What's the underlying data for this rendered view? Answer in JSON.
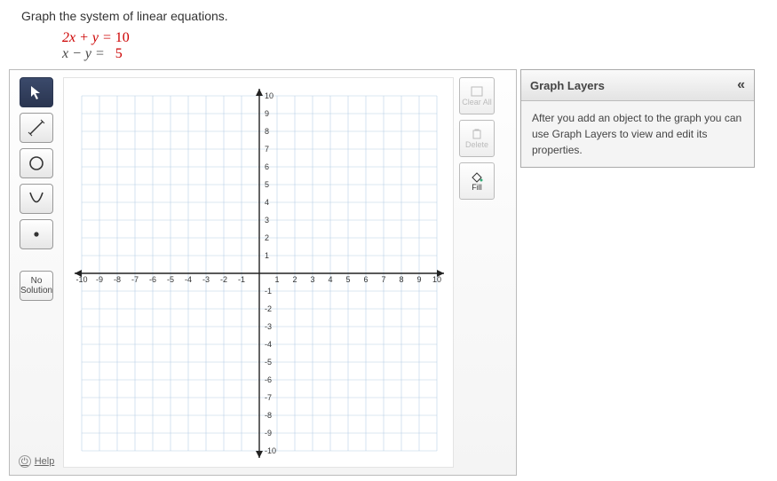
{
  "question": "Graph the system of linear equations.",
  "equations": {
    "eq1_lhs": "2x + y = ",
    "eq1_rhs": "10",
    "eq2_lhs": "x − y = ",
    "eq2_rhs": "  5"
  },
  "tools": {
    "pointer": "pointer",
    "line": "line",
    "circle": "circle",
    "parabola": "parabola",
    "point": "point",
    "no_solution": "No Solution"
  },
  "side": {
    "clear_all": "Clear All",
    "delete": "Delete",
    "fill": "Fill"
  },
  "layers": {
    "title": "Graph Layers",
    "collapse": "«",
    "hint": "After you add an object to the graph you can use Graph Layers to view and edit its properties."
  },
  "help": "Help",
  "axis": {
    "min": -10,
    "max": 10,
    "step": 1
  },
  "chart_data": {
    "type": "scatter",
    "title": "",
    "xlabel": "",
    "ylabel": "",
    "xlim": [
      -10,
      10
    ],
    "ylim": [
      -10,
      10
    ],
    "x_ticks": [
      -10,
      -9,
      -8,
      -7,
      -6,
      -5,
      -4,
      -3,
      -2,
      -1,
      1,
      2,
      3,
      4,
      5,
      6,
      7,
      8,
      9,
      10
    ],
    "y_ticks": [
      -10,
      -9,
      -8,
      -7,
      -6,
      -5,
      -4,
      -3,
      -2,
      -1,
      1,
      2,
      3,
      4,
      5,
      6,
      7,
      8,
      9,
      10
    ],
    "series": []
  }
}
